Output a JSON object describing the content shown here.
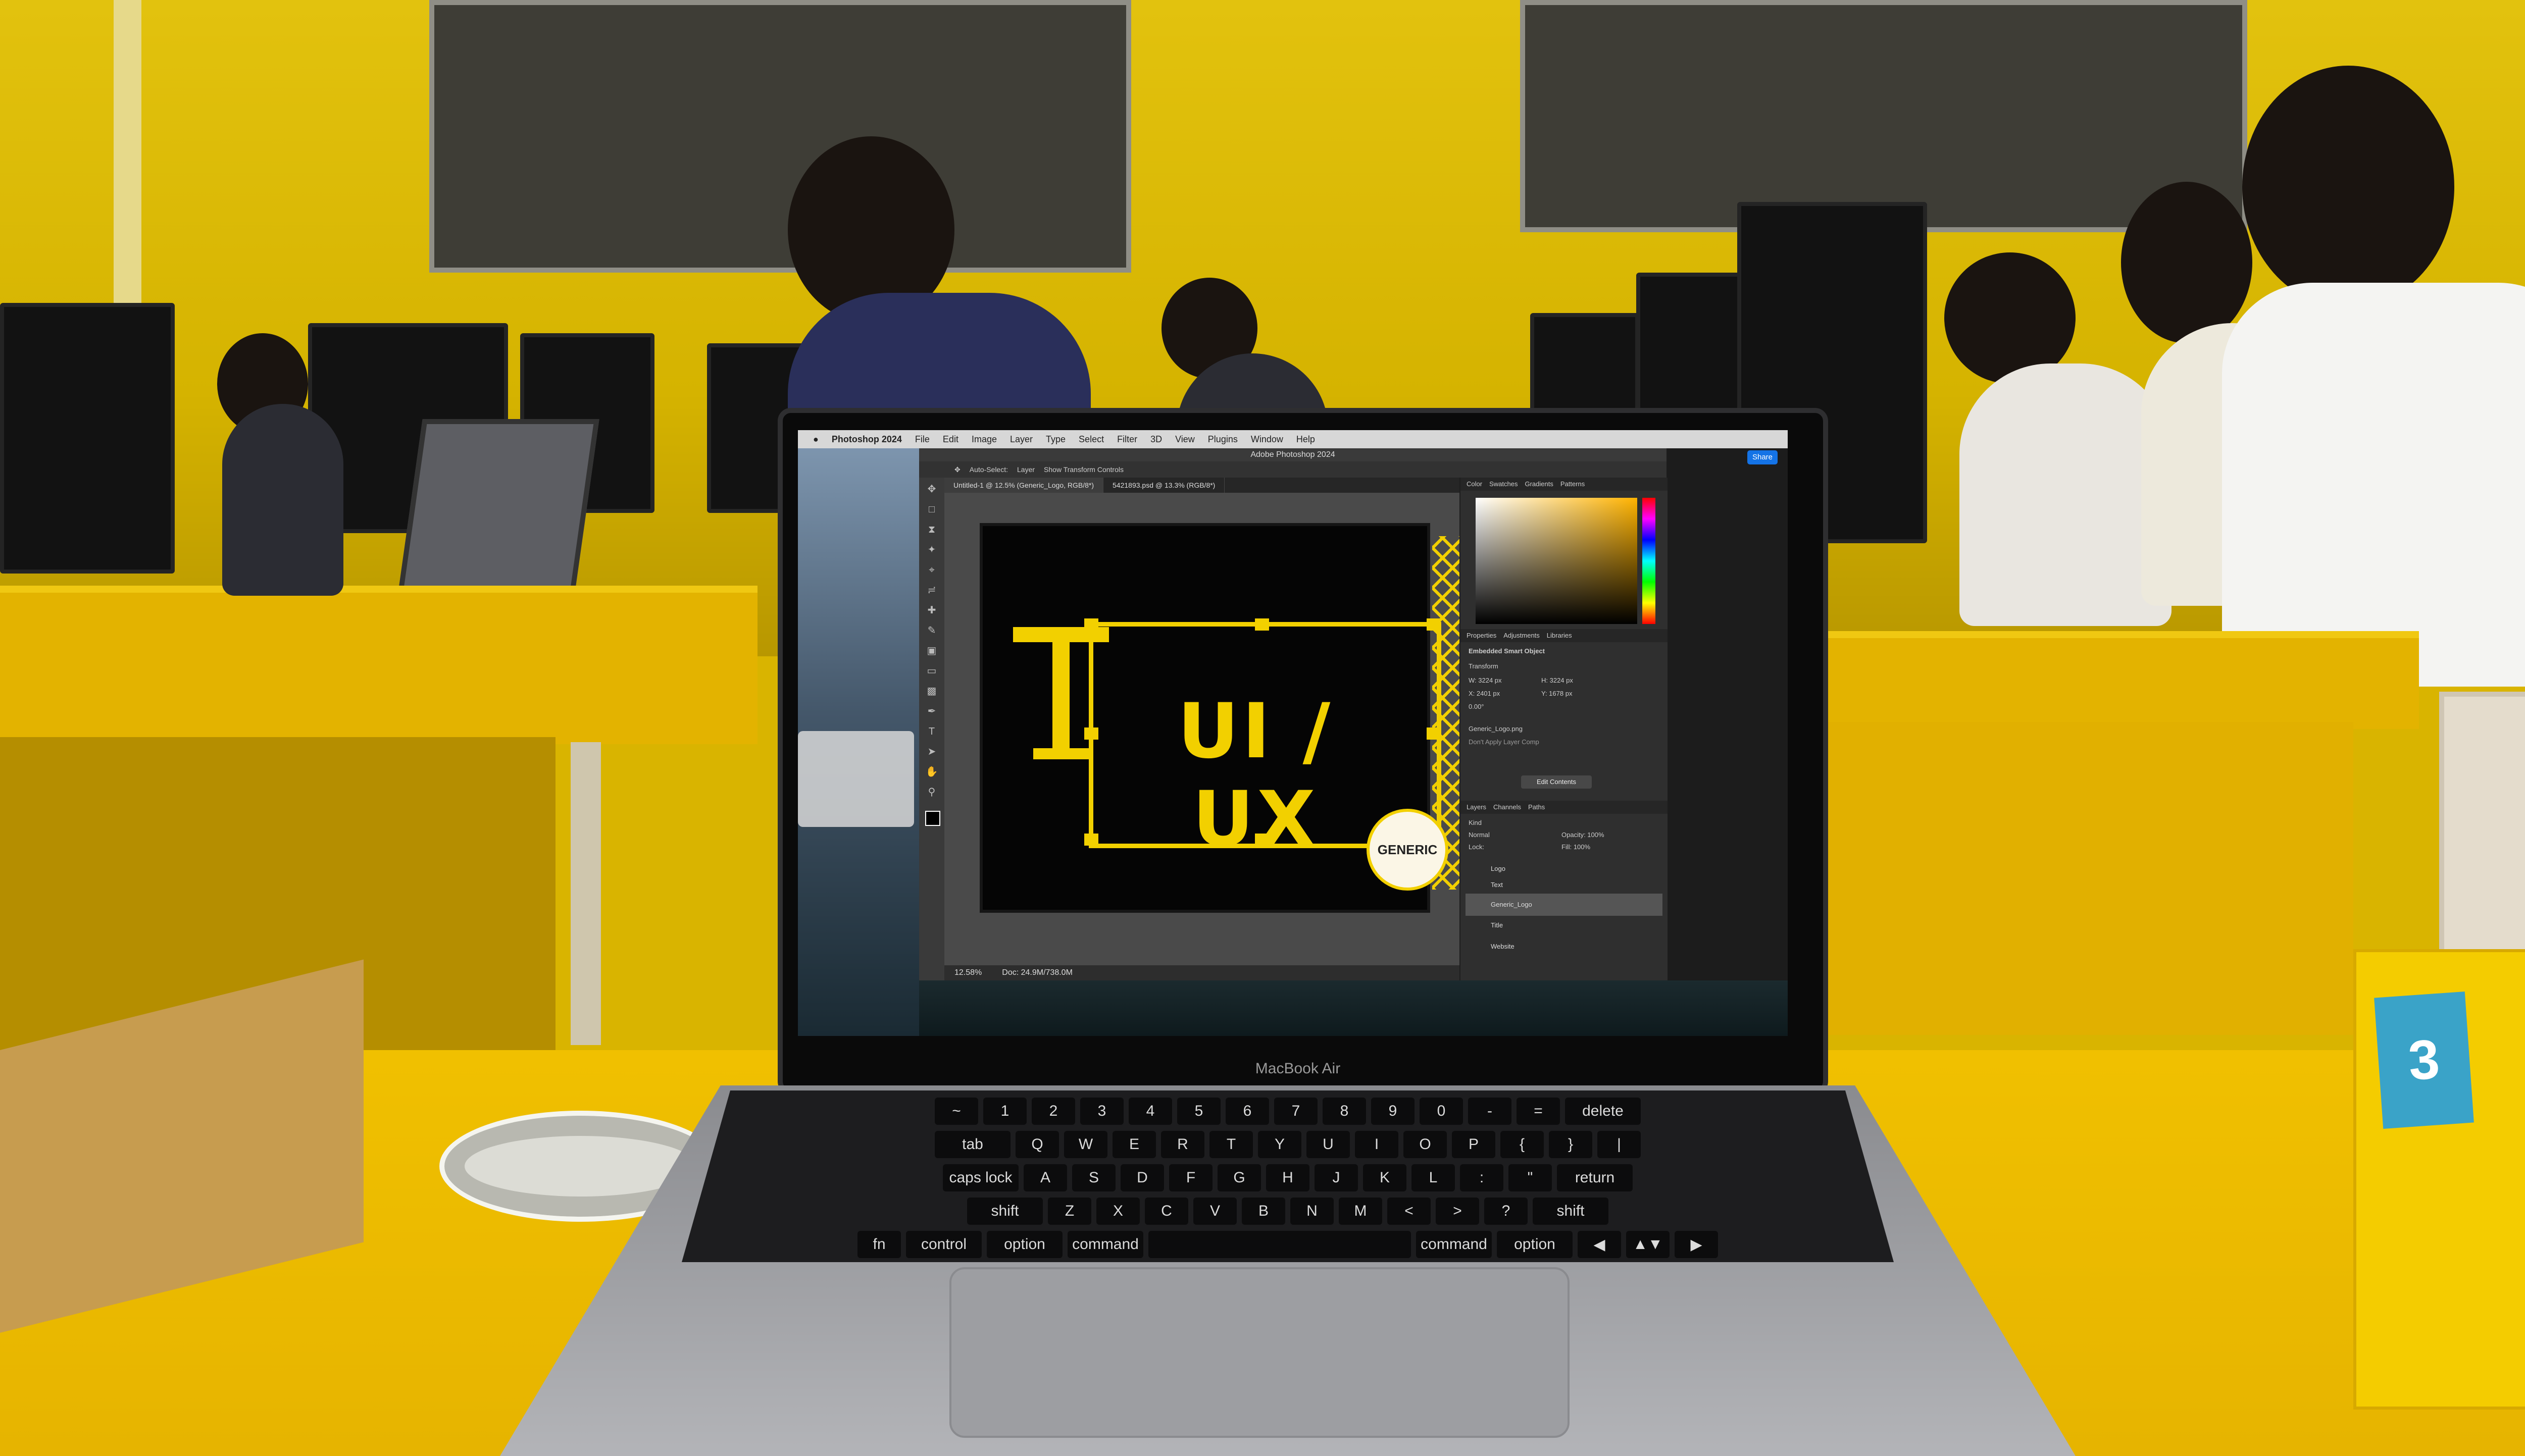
{
  "scene": {
    "description_colors": {
      "wall": "#d9b400",
      "desk": "#e6b400",
      "accent_yellow": "#f2d000",
      "photoshop_dark": "#2b2b2b"
    },
    "laptop_brand": "MacBook Air",
    "box_label": "3"
  },
  "mac_menu": {
    "app_name": "Photoshop 2024",
    "items": [
      "File",
      "Edit",
      "Image",
      "Layer",
      "Type",
      "Select",
      "Filter",
      "3D",
      "View",
      "Plugins",
      "Window",
      "Help"
    ]
  },
  "photoshop": {
    "window_title": "Adobe Photoshop 2024",
    "share_label": "Share",
    "options_bar": {
      "auto_select": "Auto-Select:",
      "auto_select_value": "Layer",
      "show_transform": "Show Transform Controls"
    },
    "tabs": [
      {
        "label": "Untitled-1 @ 12.5% (Generic_Logo, RGB/8*)",
        "active": true
      },
      {
        "label": "5421893.psd @ 13.3% (RGB/8*)",
        "active": false
      }
    ],
    "canvas": {
      "title_text": "UI / UX",
      "logo_text": "GENERIC"
    },
    "status": {
      "zoom": "12.58%",
      "doc": "Doc: 24.9M/738.0M"
    },
    "color_panel_tabs": [
      "Color",
      "Swatches",
      "Gradients",
      "Patterns"
    ],
    "properties_tabs": [
      "Properties",
      "Adjustments",
      "Libraries"
    ],
    "properties": {
      "object_type": "Embedded Smart Object",
      "transform_label": "Transform",
      "w": "W: 3224 px",
      "h": "H: 3224 px",
      "x": "X: 2401 px",
      "y": "Y: 1678 px",
      "angle": "0.00°",
      "file_name": "Generic_Logo.png",
      "dont_apply": "Don't Apply Layer Comp",
      "edit_contents": "Edit Contents"
    },
    "layers_tabs": [
      "Layers",
      "Channels",
      "Paths"
    ],
    "layers_controls": {
      "kind": "Kind",
      "blend": "Normal",
      "opacity": "Opacity: 100%",
      "lock": "Lock:",
      "fill": "Fill: 100%"
    },
    "layers": [
      {
        "name": "Logo",
        "selected": false
      },
      {
        "name": "Text",
        "selected": false
      },
      {
        "name": "Generic_Logo",
        "selected": true
      },
      {
        "name": "Title",
        "selected": false
      },
      {
        "name": "Website",
        "selected": false
      }
    ]
  },
  "keyboard": {
    "rows": [
      [
        "~",
        "1",
        "2",
        "3",
        "4",
        "5",
        "6",
        "7",
        "8",
        "9",
        "0",
        "-",
        "=",
        "delete"
      ],
      [
        "tab",
        "Q",
        "W",
        "E",
        "R",
        "T",
        "Y",
        "U",
        "I",
        "O",
        "P",
        "{",
        "}",
        "|"
      ],
      [
        "caps lock",
        "A",
        "S",
        "D",
        "F",
        "G",
        "H",
        "J",
        "K",
        "L",
        ":",
        "\"",
        "return"
      ],
      [
        "shift",
        "Z",
        "X",
        "C",
        "V",
        "B",
        "N",
        "M",
        "<",
        ">",
        "?",
        "shift"
      ],
      [
        "fn",
        "control",
        "option",
        "command",
        "",
        "command",
        "option",
        "◀",
        "▲▼",
        "▶"
      ]
    ]
  }
}
